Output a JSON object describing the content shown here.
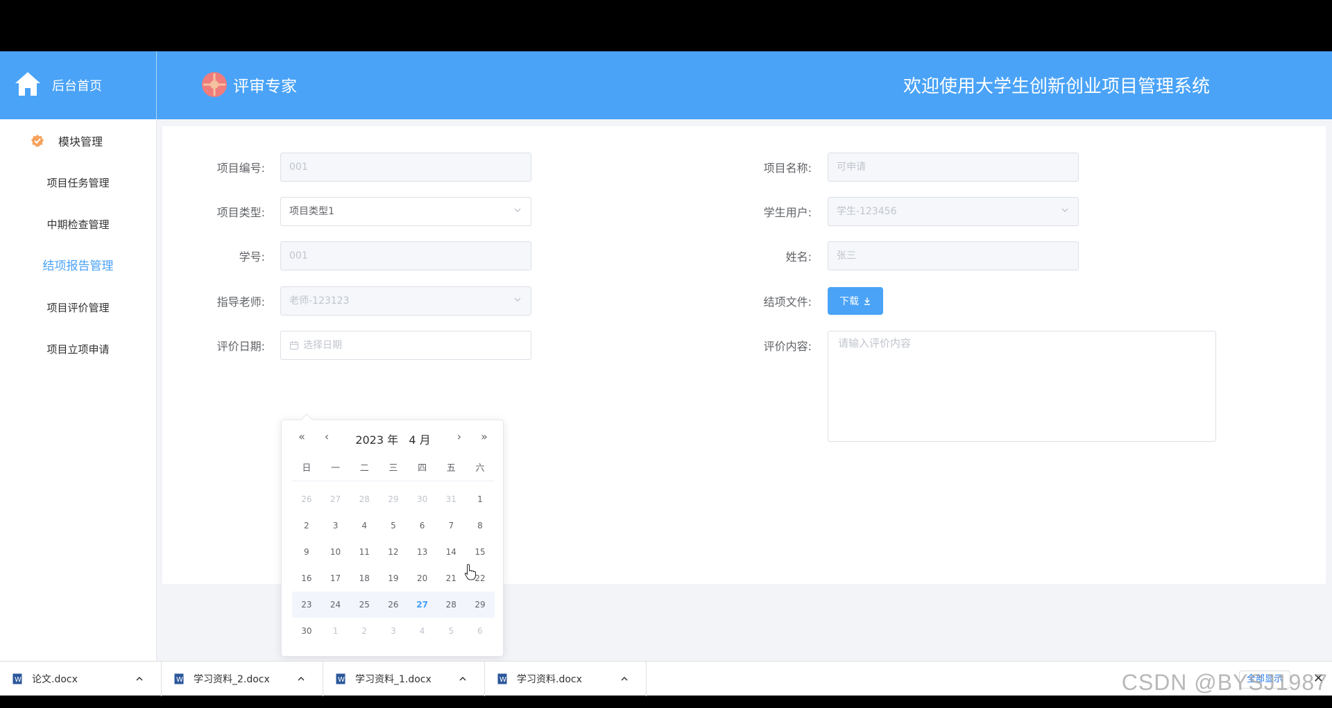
{
  "header": {
    "home_label": "后台首页",
    "role_label": "评审专家",
    "system_title": "欢迎使用大学生创新创业项目管理系统"
  },
  "sidebar": {
    "group_label": "模块管理",
    "items": [
      {
        "label": "项目任务管理"
      },
      {
        "label": "中期检查管理"
      },
      {
        "label": "结项报告管理"
      },
      {
        "label": "项目评价管理"
      },
      {
        "label": "项目立项申请"
      }
    ]
  },
  "form": {
    "project_no": {
      "label": "项目编号:",
      "value": "001"
    },
    "project_name": {
      "label": "项目名称:",
      "value": "可申请"
    },
    "project_type": {
      "label": "项目类型:",
      "value": "项目类型1"
    },
    "student_user": {
      "label": "学生用户:",
      "value": "学生-123456"
    },
    "student_id": {
      "label": "学号:",
      "value": "001"
    },
    "name": {
      "label": "姓名:",
      "value": "张三"
    },
    "advisor": {
      "label": "指导老师:",
      "value": "老师-123123"
    },
    "final_file": {
      "label": "结项文件:",
      "button": "下载"
    },
    "eval_date": {
      "label": "评价日期:",
      "placeholder": "选择日期"
    },
    "eval_content": {
      "label": "评价内容:",
      "placeholder": "请输入评价内容"
    }
  },
  "datepicker": {
    "year_label": "2023 年",
    "month_label": "4 月",
    "nav": {
      "prev_year": "«",
      "prev_month": "‹",
      "next_month": "›",
      "next_year": "»"
    },
    "weekdays": [
      "日",
      "一",
      "二",
      "三",
      "四",
      "五",
      "六"
    ],
    "weeks": [
      [
        "26",
        "27",
        "28",
        "29",
        "30",
        "31",
        "1"
      ],
      [
        "2",
        "3",
        "4",
        "5",
        "6",
        "7",
        "8"
      ],
      [
        "9",
        "10",
        "11",
        "12",
        "13",
        "14",
        "15"
      ],
      [
        "16",
        "17",
        "18",
        "19",
        "20",
        "21",
        "22"
      ],
      [
        "23",
        "24",
        "25",
        "26",
        "27",
        "28",
        "29"
      ],
      [
        "30",
        "1",
        "2",
        "3",
        "4",
        "5",
        "6"
      ]
    ],
    "today": "27"
  },
  "downloads": {
    "items": [
      {
        "name": "论文.docx"
      },
      {
        "name": "学习资料_2.docx"
      },
      {
        "name": "学习资料_1.docx"
      },
      {
        "name": "学习资料.docx"
      }
    ],
    "show_all": "全部显示",
    "close": "✕"
  },
  "watermark": "CSDN @BYSJ1987",
  "colors": {
    "primary": "#4aa3f7",
    "sidebar_active": "#4aa3f7",
    "today": "#409eff"
  }
}
